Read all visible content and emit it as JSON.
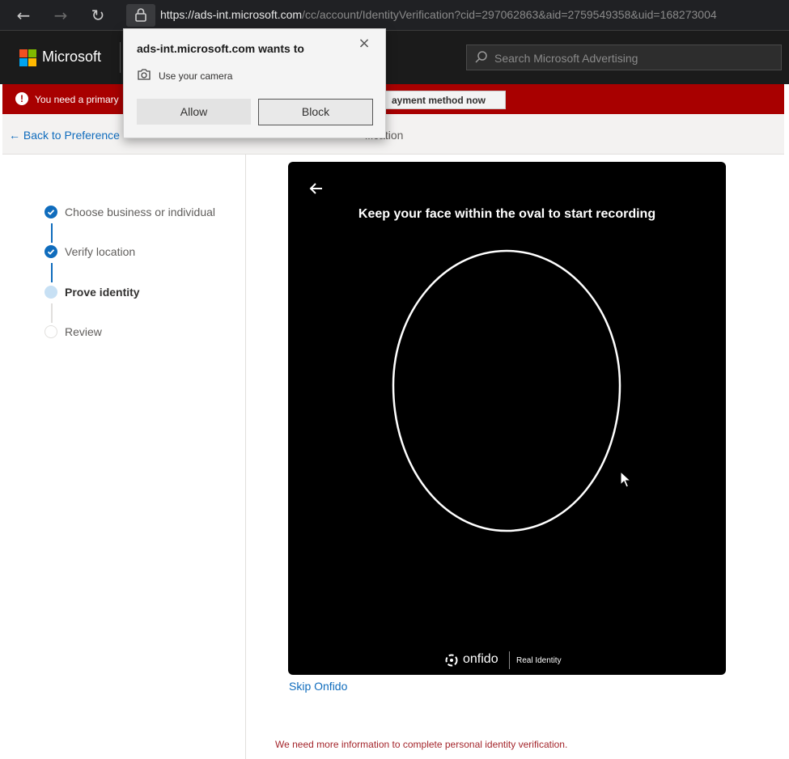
{
  "browser": {
    "url_host": "https://ads-int.microsoft.com",
    "url_path": "/cc/account/IdentityVerification?cid=297062863&aid=2759549358&uid=168273004"
  },
  "header": {
    "brand": "Microsoft",
    "search_placeholder": "Search Microsoft Advertising"
  },
  "alert": {
    "text": "You need a primary",
    "button_label": "ayment method now",
    "color": "#a80000"
  },
  "breadcrumb": {
    "back_label": "Back to Preference",
    "title_fragment": "ification"
  },
  "steps": [
    {
      "label": "Choose business or individual",
      "status": "done"
    },
    {
      "label": "Verify location",
      "status": "done"
    },
    {
      "label": "Prove identity",
      "status": "current"
    },
    {
      "label": "Review",
      "status": "pending"
    }
  ],
  "capture": {
    "instruction": "Keep your face within the oval to start recording",
    "brand": "onfido",
    "tagline": "Real Identity"
  },
  "skip_label": "Skip Onfido",
  "error_message": "We need more information to complete personal identity verification.",
  "permission_popup": {
    "title": "ads-int.microsoft.com wants to",
    "request": "Use your camera",
    "allow_label": "Allow",
    "block_label": "Block"
  },
  "colors": {
    "accent": "#0f6cbd",
    "error": "#a4262c"
  }
}
